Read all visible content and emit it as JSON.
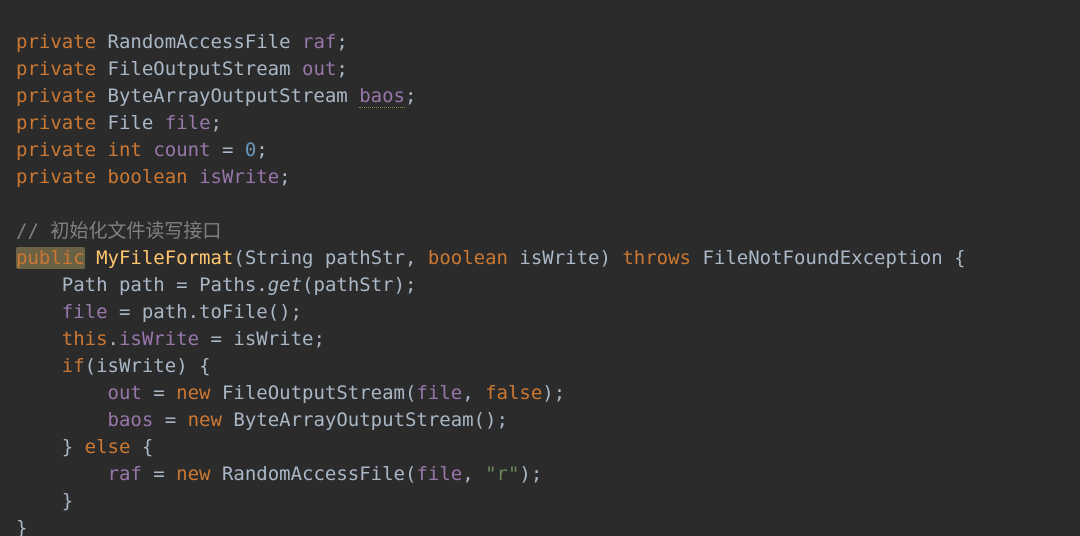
{
  "code": {
    "l1": {
      "kw": "private",
      "type": "RandomAccessFile",
      "id": "raf",
      "semi": ";"
    },
    "l2": {
      "kw": "private",
      "type": "FileOutputStream",
      "id": "out",
      "semi": ";"
    },
    "l3": {
      "kw": "private",
      "type": "ByteArrayOutputStream",
      "id": "baos",
      "semi": ";"
    },
    "l4": {
      "kw": "private",
      "type": "File",
      "id": "file",
      "semi": ";"
    },
    "l5": {
      "kw": "private",
      "type": "int",
      "id": "count",
      "eq": " = ",
      "val": "0",
      "semi": ";"
    },
    "l6": {
      "kw": "private",
      "type": "boolean",
      "id": "isWrite",
      "semi": ";"
    },
    "l7": {
      "cmt": "// 初始化文件读写接口"
    },
    "l8": {
      "pub": "public",
      "name": "MyFileFormat",
      "open": "(",
      "p1t": "String",
      "p1n": " pathStr",
      "c": ", ",
      "p2t": "boolean",
      "p2n": " isWrite",
      "close": ") ",
      "thr": "throws",
      "exc": " FileNotFoundException ",
      "br": "{"
    },
    "l9": {
      "t": "Path",
      "v": " path ",
      "eq": "= ",
      "cls": "Paths",
      "dot": ".",
      "m": "get",
      "open": "(",
      "arg": "pathStr",
      "close": ")",
      "semi": ";"
    },
    "l10": {
      "f": "file",
      "rest": " = path.toFile();"
    },
    "l11": {
      "a": "this",
      "dot": ".",
      "f": "isWrite",
      "rest": " = isWrite;"
    },
    "l12": {
      "a": "if",
      "open": "(",
      "cond": "isWrite",
      "close": ") {"
    },
    "l13": {
      "f": "out",
      "eq": " = ",
      "kw": "new",
      "sp": " ",
      "t": "FileOutputStream",
      "open": "(",
      "a1": "file",
      "c": ", ",
      "a2": "false",
      "close": ");"
    },
    "l14": {
      "f": "baos",
      "eq": " = ",
      "kw": "new",
      "sp": " ",
      "t": "ByteArrayOutputStream",
      "open": "();"
    },
    "l15": {
      "a": "} ",
      "kw": "else",
      "b": " {"
    },
    "l16": {
      "f": "raf",
      "eq": " = ",
      "kw": "new",
      "sp": " ",
      "t": "RandomAccessFile",
      "open": "(",
      "a1": "file",
      "c": ", ",
      "s": "\"r\"",
      "close": ");"
    },
    "l17": {
      "b": "}"
    },
    "l18": {
      "b": "}"
    }
  }
}
